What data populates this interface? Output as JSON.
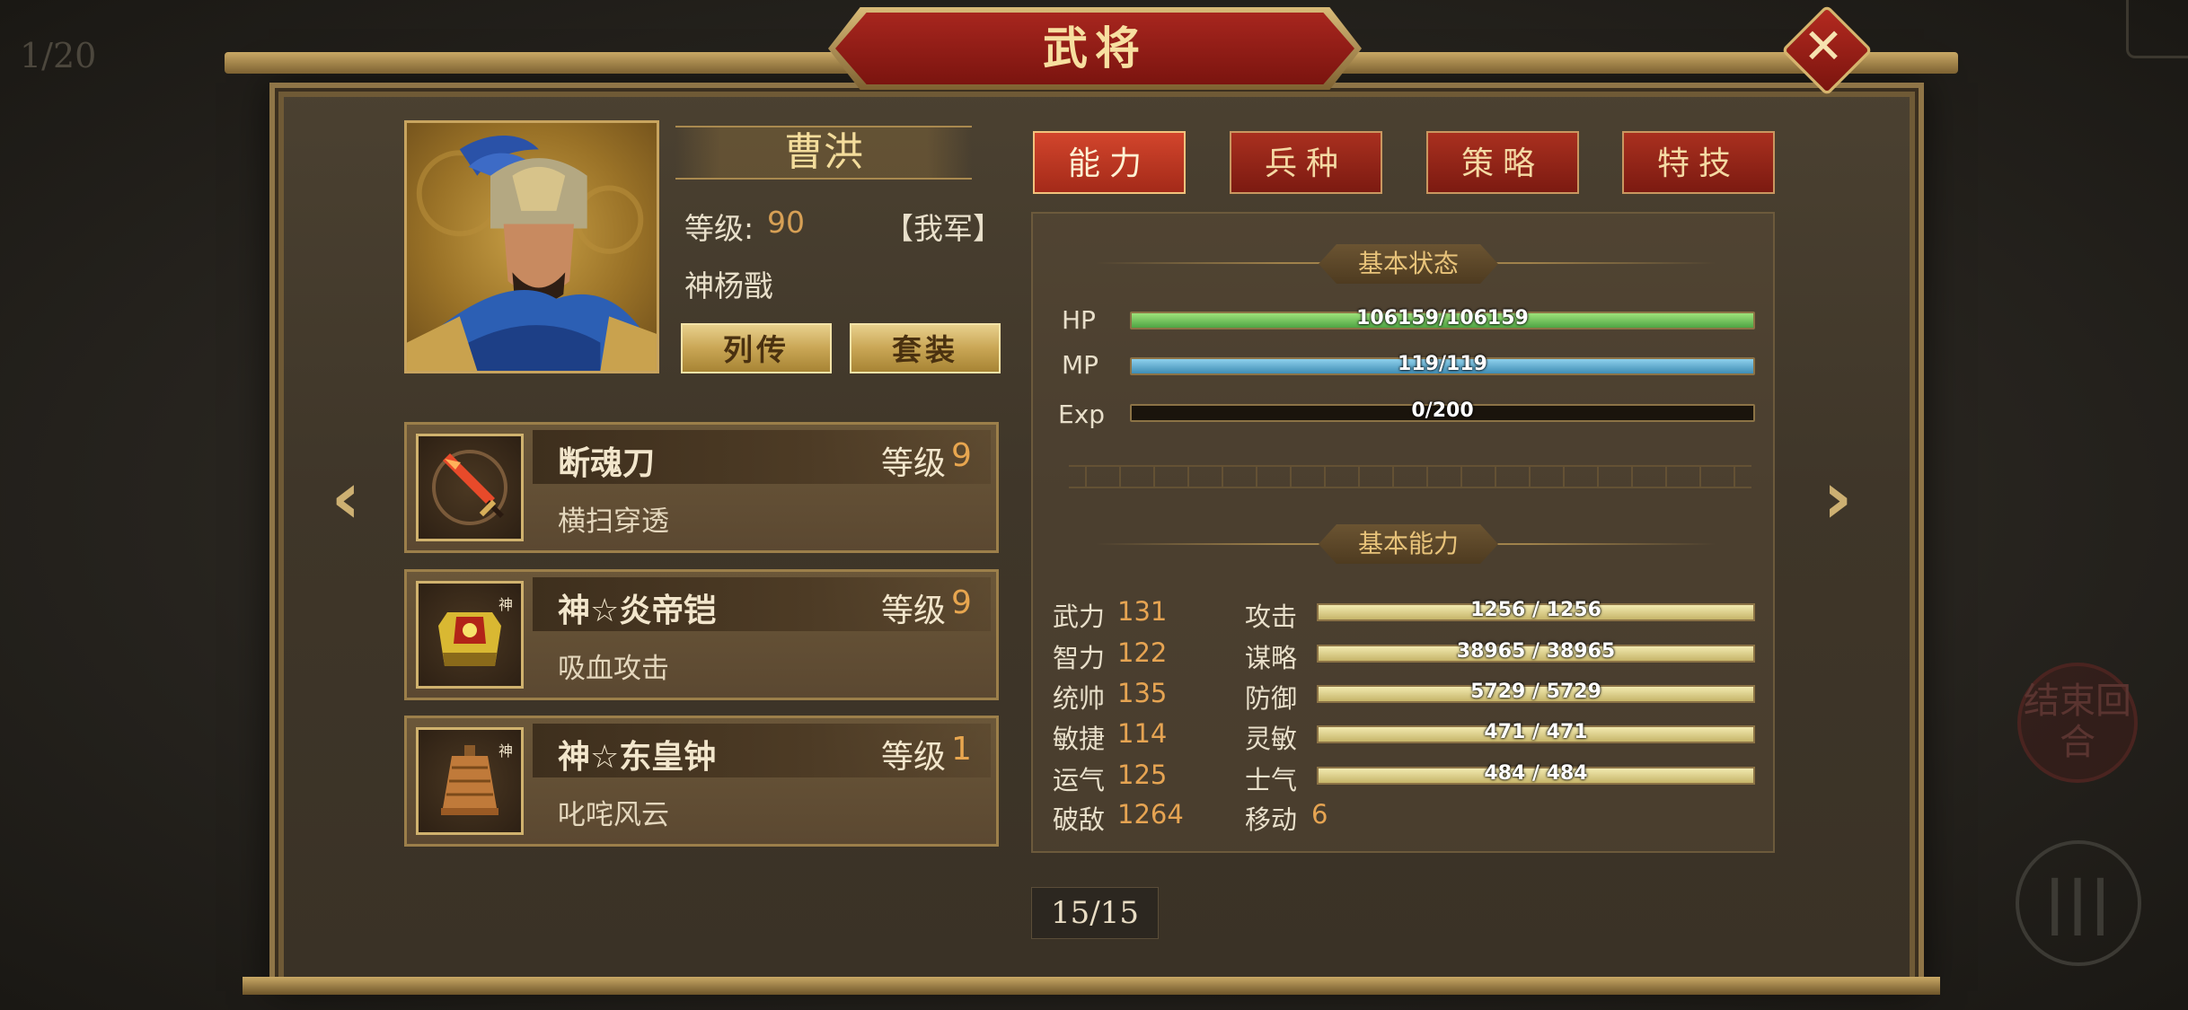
{
  "page_counter": "1/20",
  "title": "武将",
  "hero": {
    "name": "曹洪",
    "level_label": "等级:",
    "level": "90",
    "faction": "【我军】",
    "weapon": "神杨戬"
  },
  "buttons": {
    "bio": "列传",
    "set": "套装"
  },
  "equipment": [
    {
      "name": "断魂刀",
      "level_label": "等级",
      "level": "9",
      "skill": "横扫穿透",
      "icon": "red-blade-icon"
    },
    {
      "name": "神☆炎帝铠",
      "level_label": "等级",
      "level": "9",
      "skill": "吸血攻击",
      "icon": "gold-armor-icon"
    },
    {
      "name": "神☆东皇钟",
      "level_label": "等级",
      "level": "1",
      "skill": "叱咤风云",
      "icon": "bronze-bell-icon"
    }
  ],
  "tabs": [
    "能力",
    "兵种",
    "策略",
    "特技"
  ],
  "active_tab": 0,
  "status": {
    "section_title": "基本状态",
    "hp": {
      "label": "HP",
      "text": "106159/106159",
      "ratio": 1.0
    },
    "mp": {
      "label": "MP",
      "text": "119/119",
      "ratio": 1.0
    },
    "exp": {
      "label": "Exp",
      "text": "0/200",
      "ratio": 0.0
    }
  },
  "ability": {
    "section_title": "基本能力",
    "attributes": [
      {
        "name": "武力",
        "value": "131"
      },
      {
        "name": "智力",
        "value": "122"
      },
      {
        "name": "统帅",
        "value": "135"
      },
      {
        "name": "敏捷",
        "value": "114"
      },
      {
        "name": "运气",
        "value": "125"
      },
      {
        "name": "破敌",
        "value": "1264"
      }
    ],
    "combat": [
      {
        "name": "攻击",
        "text": "1256 / 1256",
        "ratio": 1.0
      },
      {
        "name": "谋略",
        "text": "38965 / 38965",
        "ratio": 1.0
      },
      {
        "name": "防御",
        "text": "5729 / 5729",
        "ratio": 1.0
      },
      {
        "name": "灵敏",
        "text": "471 / 471",
        "ratio": 1.0
      },
      {
        "name": "士气",
        "text": "484 / 484",
        "ratio": 1.0
      }
    ],
    "move": {
      "name": "移动",
      "value": "6"
    }
  },
  "pager": "15/15",
  "end_turn": "结束回合",
  "colors": {
    "title_red": "#a7261e",
    "gold": "#c9a655",
    "value_orange": "#e6a452",
    "hp_green": "#4fa544",
    "mp_blue": "#3f8db4"
  }
}
